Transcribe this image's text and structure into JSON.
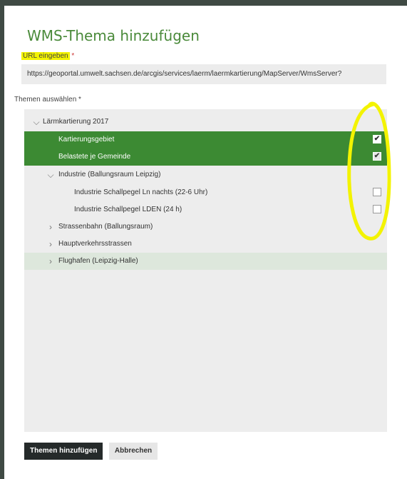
{
  "dialog": {
    "title": "WMS-Thema hinzufügen",
    "url_label": "URL eingeben",
    "url_required_mark": "*",
    "url_value": "https://geoportal.umwelt.sachsen.de/arcgis/services/laerm/laermkartierung/MapServer/WmsServer?",
    "themes_label": "Themen auswählen *"
  },
  "tree": {
    "items": [
      {
        "label": "Lärmkartierung 2017",
        "chevron": "⌵"
      },
      {
        "label": "Kartierungsgebiet",
        "checked": true
      },
      {
        "label": "Belastete je Gemeinde",
        "checked": true
      },
      {
        "label": "Industrie (Ballungsraum Leipzig)",
        "chevron": "⌵"
      },
      {
        "label": "Industrie Schallpegel Ln nachts (22-6 Uhr)",
        "checked": false
      },
      {
        "label": "Industrie Schallpegel LDEN (24 h)",
        "checked": false
      },
      {
        "label": "Strassenbahn (Ballungsraum)",
        "chevron": "›"
      },
      {
        "label": "Hauptverkehrsstrassen",
        "chevron": "›"
      },
      {
        "label": "Flughafen (Leipzig-Halle)",
        "chevron": "›"
      }
    ]
  },
  "actions": {
    "add_label": "Themen hinzufügen",
    "cancel_label": "Abbrechen"
  },
  "colors": {
    "accent": "#3c8a33",
    "title": "#4a8a3a",
    "highlight": "#f3f300"
  }
}
